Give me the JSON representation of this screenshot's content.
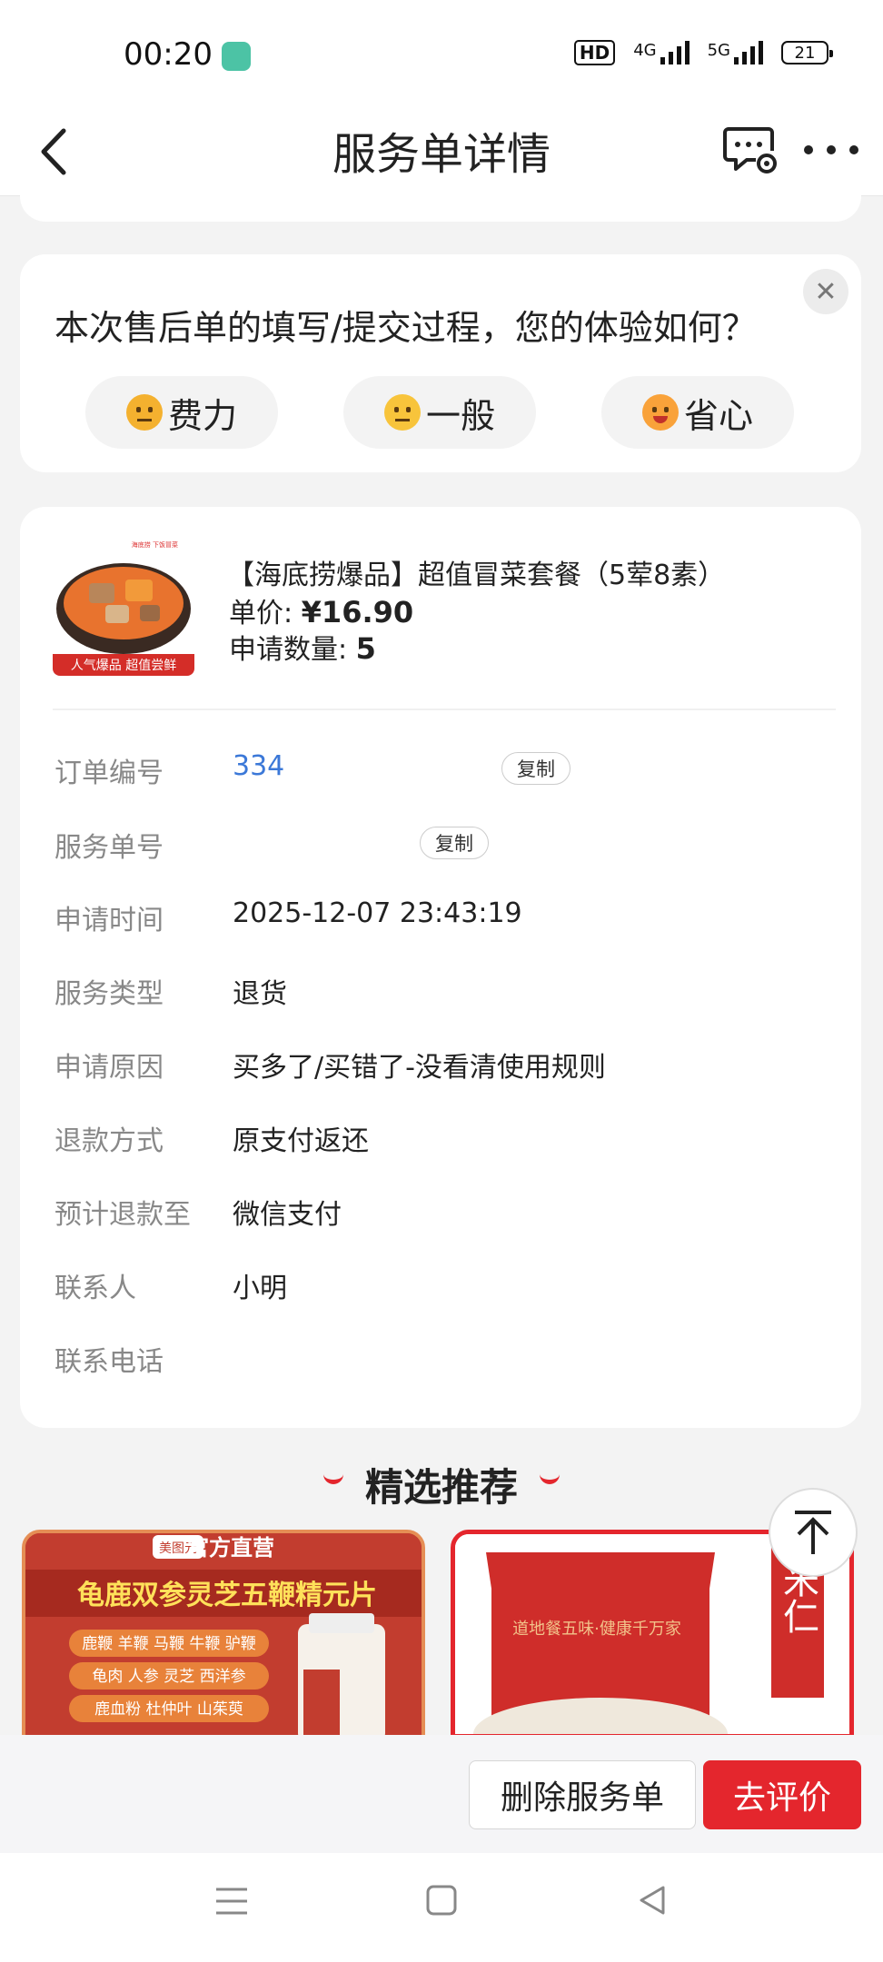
{
  "status_bar": {
    "time": "00:20",
    "network_1": "4G",
    "network_2": "5G",
    "hd": "HD",
    "battery": "21"
  },
  "nav": {
    "title": "服务单详情"
  },
  "survey": {
    "question": "本次售后单的填写/提交过程，您的体验如何？",
    "options": [
      {
        "label": "费力",
        "icon": "annoyed-face-icon"
      },
      {
        "label": "一般",
        "icon": "neutral-face-icon"
      },
      {
        "label": "省心",
        "icon": "happy-face-icon"
      }
    ],
    "close_icon": "close-icon"
  },
  "product": {
    "name": "【海底捞爆品】超值冒菜套餐（5荤8素）",
    "image_caption": "人气爆品 超值尝鲜",
    "image_top_text": "海底捞 下饭冒菜",
    "price_label": "单价:",
    "price": "¥16.90",
    "qty_label": "申请数量:",
    "qty": "5"
  },
  "details": [
    {
      "label": "订单编号",
      "value": "334"
    },
    {
      "label": "服务单号",
      "value": ""
    },
    {
      "label": "申请时间",
      "value": "2025-12-07 23:43:19"
    },
    {
      "label": "服务类型",
      "value": "退货"
    },
    {
      "label": "申请原因",
      "value": "买多了/买错了-没看清使用规则"
    },
    {
      "label": "退款方式",
      "value": "原支付返还"
    },
    {
      "label": "预计退款至",
      "value": "微信支付"
    },
    {
      "label": "联系人",
      "value": "小明"
    },
    {
      "label": "联系电话",
      "value": ""
    }
  ],
  "copy_label_1": "复制",
  "copy_label_2": "复制",
  "recommend": {
    "title": "精选推荐",
    "item1": {
      "brand": "美图元",
      "badge": "官方直营",
      "title": "龟鹿双参灵芝五鞭精元片",
      "lines": [
        "鹿鞭 羊鞭 马鞭 牛鞭 驴鞭",
        "龟肉 人参 灵芝 西洋参",
        "鹿血粉 杜仲叶 山茱萸"
      ]
    },
    "item2": {
      "side_text": "薏米仁",
      "bag_text": "道地餐五味·健康千万家"
    }
  },
  "actions": {
    "delete": "删除服务单",
    "rate": "去评价"
  },
  "colors": {
    "accent": "#e4262d",
    "link": "#3b78d8",
    "bg": "#f3f3f3"
  }
}
